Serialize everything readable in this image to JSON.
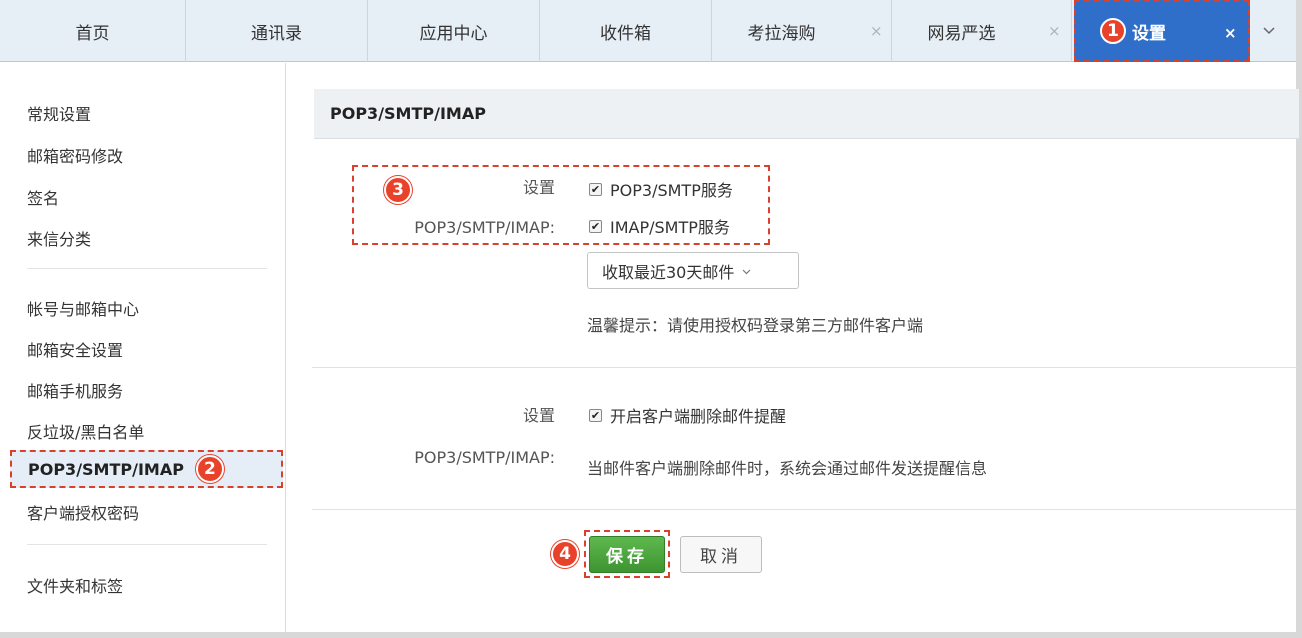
{
  "tabs": [
    {
      "label": "首页",
      "closable": false
    },
    {
      "label": "通讯录",
      "closable": false
    },
    {
      "label": "应用中心",
      "closable": false
    },
    {
      "label": "收件箱",
      "closable": false
    },
    {
      "label": "考拉海购",
      "closable": true
    },
    {
      "label": "网易严选",
      "closable": true
    },
    {
      "label": "设置",
      "closable": true,
      "active": true,
      "step": "1"
    }
  ],
  "tab_close_glyph": "×",
  "tab_more_icon": "chevron-down-icon",
  "sidebar": {
    "groups": [
      [
        "常规设置",
        "邮箱密码修改",
        "签名",
        "来信分类"
      ],
      [
        "帐号与邮箱中心",
        "邮箱安全设置",
        "邮箱手机服务",
        "反垃圾/黑白名单",
        "POP3/SMTP/IMAP",
        "客户端授权密码"
      ],
      [
        "文件夹和标签"
      ]
    ],
    "active_item": "POP3/SMTP/IMAP",
    "active_step": "2"
  },
  "main": {
    "section_title": "POP3/SMTP/IMAP",
    "block1": {
      "step": "3",
      "label_line1": "设置",
      "label_line2": "POP3/SMTP/IMAP:",
      "options": [
        {
          "label": "POP3/SMTP服务",
          "checked": true
        },
        {
          "label": "IMAP/SMTP服务",
          "checked": true
        }
      ],
      "select_value": "收取最近30天邮件",
      "hint": "温馨提示：请使用授权码登录第三方邮件客户端"
    },
    "block2": {
      "label_line1": "设置",
      "label_line2": "POP3/SMTP/IMAP:",
      "option": {
        "label": "开启客户端删除邮件提醒",
        "checked": true
      },
      "description": "当邮件客户端删除邮件时，系统会通过邮件发送提醒信息"
    },
    "save_step": "4",
    "save_label": "保存",
    "cancel_label": "取消"
  },
  "colors": {
    "tab_active_bg": "#2f6fc9",
    "annotation_red": "#e8422b",
    "save_green": "#4aa23c",
    "tabbar_bg": "#e6eef6"
  }
}
